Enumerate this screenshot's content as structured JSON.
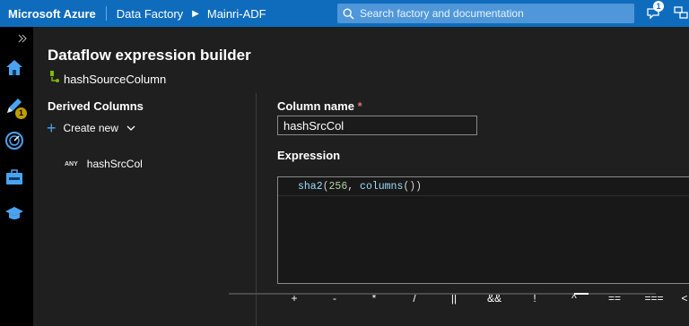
{
  "topbar": {
    "brand": "Microsoft Azure",
    "breadcrumb": [
      "Data Factory",
      "Mainri-ADF"
    ],
    "search_placeholder": "Search factory and documentation",
    "notification_count": "1"
  },
  "rail": {
    "items": [
      "expand-icon",
      "home-icon",
      "author-icon",
      "monitor-icon",
      "manage-icon",
      "learning-icon"
    ],
    "author_badge": "1"
  },
  "builder": {
    "title": "Dataflow expression builder",
    "transform_name": "hashSourceColumn",
    "derived_columns_header": "Derived Columns",
    "create_new": "Create new",
    "columns": [
      {
        "type_tag": "ANY",
        "name": "hashSrcCol"
      }
    ],
    "column_name_label": "Column name",
    "required_mark": "*",
    "column_name_value": "hashSrcCol",
    "expression_label": "Expression",
    "expression": {
      "fn": "sha2",
      "open": "(",
      "arg1": "256",
      "comma": ", ",
      "arg2": "columns",
      "close": "())"
    },
    "operators": [
      "+",
      "-",
      "*",
      "/",
      "||",
      "&&",
      "!",
      "^",
      "==",
      "===",
      "<"
    ]
  },
  "colors": {
    "topbar": "#0f6cbd",
    "accent": "#4ba3f0",
    "badge": "#c19c00"
  }
}
